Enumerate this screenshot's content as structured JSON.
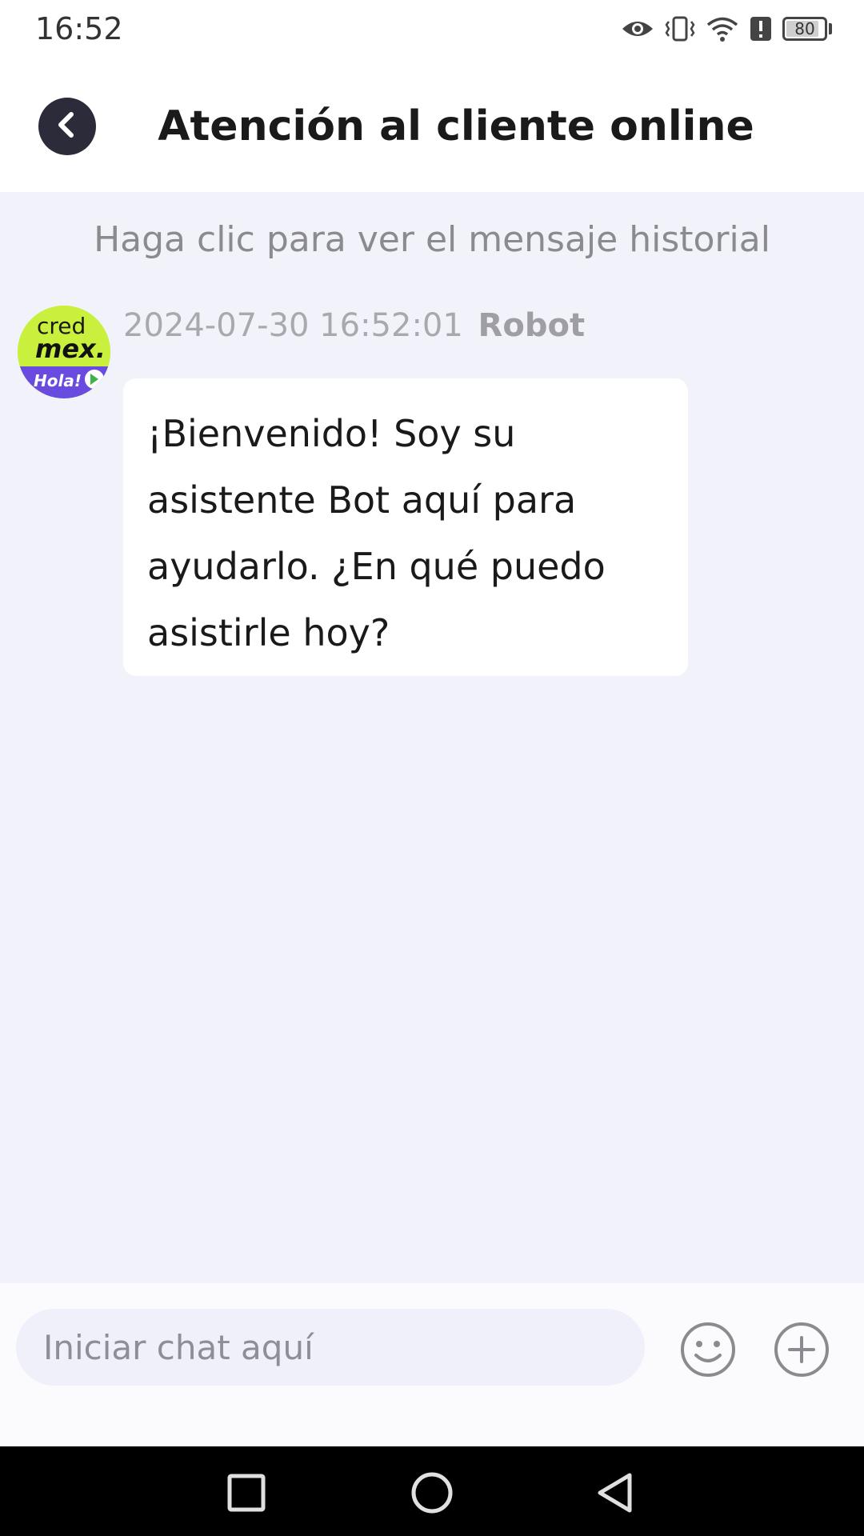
{
  "status_bar": {
    "time": "16:52",
    "battery_level": "80",
    "icons": [
      "eye-icon",
      "vibrate-icon",
      "wifi-icon",
      "alert-icon",
      "battery-icon"
    ]
  },
  "header": {
    "title": "Atención al cliente online",
    "back_icon": "chevron-left-icon"
  },
  "chat": {
    "history_link": "Haga clic para ver el mensaje historial",
    "messages": [
      {
        "timestamp": "2024-07-30 16:52:01",
        "sender": "Robot",
        "avatar": {
          "line1": "cred",
          "line2": "mex.",
          "line3": "Hola!"
        },
        "text": "¡Bienvenido! Soy su asistente Bot aquí para ayudarlo. ¿En qué puedo asistirle hoy?"
      }
    ]
  },
  "input_bar": {
    "placeholder": "Iniciar chat aquí",
    "value": "",
    "emoji_icon": "smiley-icon",
    "plus_icon": "plus-circle-icon"
  },
  "nav_bar": {
    "items": [
      "recents-icon",
      "home-icon",
      "back-icon"
    ]
  },
  "colors": {
    "chat_background": "#f2f2fb",
    "back_button": "#2b2b3a",
    "avatar_green": "#c8f03c",
    "avatar_purple": "#6a4be0"
  }
}
